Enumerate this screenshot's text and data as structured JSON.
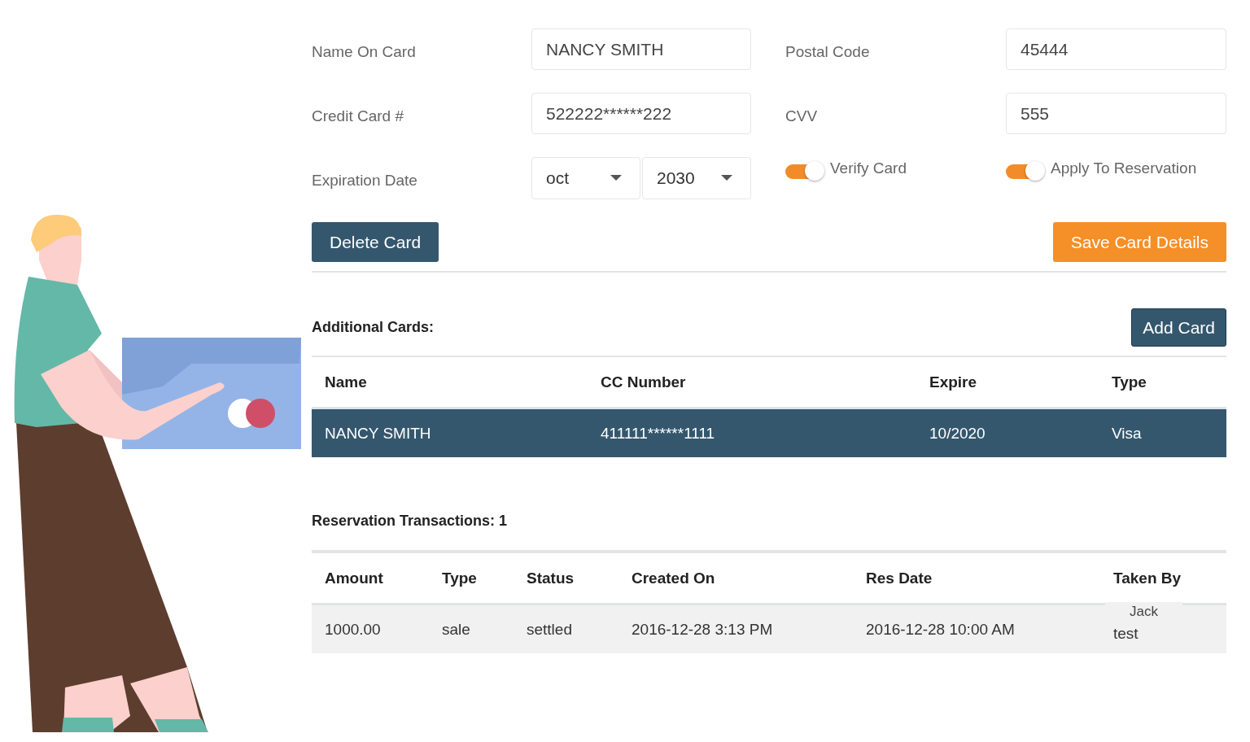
{
  "form": {
    "fields": [
      {
        "label": "Name On Card",
        "value": "NANCY SMITH"
      },
      {
        "label": "Postal Code",
        "value": "45444"
      },
      {
        "label": "Credit Card #",
        "value": "522222******222"
      },
      {
        "label": "CVV",
        "value": "555"
      }
    ],
    "expiration": {
      "label": "Expiration Date",
      "month": "oct",
      "year": "2030"
    },
    "toggles": [
      {
        "label": "Verify Card",
        "on": true
      },
      {
        "label": "Apply To Reservation",
        "on": true
      }
    ],
    "delete_button": "Delete Card",
    "save_button": "Save Card Details"
  },
  "cards": {
    "title": "Additional Cards:",
    "add_button": "Add Card",
    "columns": [
      "Name",
      "CC Number",
      "Expire",
      "Type"
    ],
    "rows": [
      {
        "cells": [
          "NANCY SMITH",
          "411111******1111",
          "10/2020",
          "Visa"
        ],
        "selected": true
      }
    ]
  },
  "transactions": {
    "title": "Reservation Transactions: 1",
    "columns": [
      "Amount",
      "Type",
      "Status",
      "Created On",
      "Res Date",
      "Taken By"
    ],
    "rows": [
      {
        "cells": [
          "1000.00",
          "sale",
          "settled",
          "2016-12-28 3:13 PM",
          "2016-12-28 10:00 AM",
          "test"
        ],
        "tooltip": "Jack"
      }
    ]
  }
}
